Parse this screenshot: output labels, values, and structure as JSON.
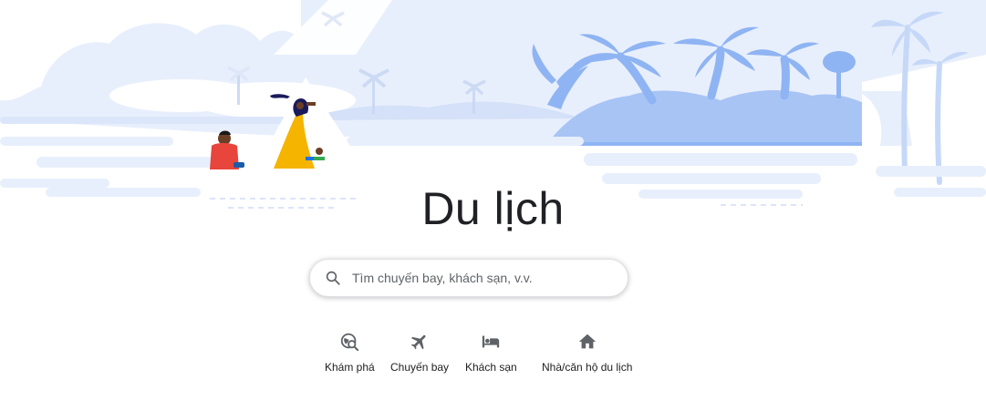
{
  "page": {
    "title": "Du lịch"
  },
  "search": {
    "placeholder": "Tìm chuyến bay, khách sạn, v.v.",
    "value": ""
  },
  "nav": {
    "items": [
      {
        "label": "Khám phá",
        "icon": "explore-search-icon"
      },
      {
        "label": "Chuyến bay",
        "icon": "airplane-icon"
      },
      {
        "label": "Khách sạn",
        "icon": "bed-icon"
      },
      {
        "label": "Nhà/căn hộ du lịch",
        "icon": "house-icon"
      }
    ]
  },
  "colors": {
    "hero_light": "#e8effc",
    "hero_mid": "#c6d8f8",
    "hero_blue": "#8fb4f3",
    "hero_accent": "#a8c4f5",
    "text": "#202124",
    "icon_gray": "#5f6368",
    "dress_yellow": "#f5b400",
    "shirt_red": "#e8453c",
    "shirt_green": "#34a853"
  }
}
